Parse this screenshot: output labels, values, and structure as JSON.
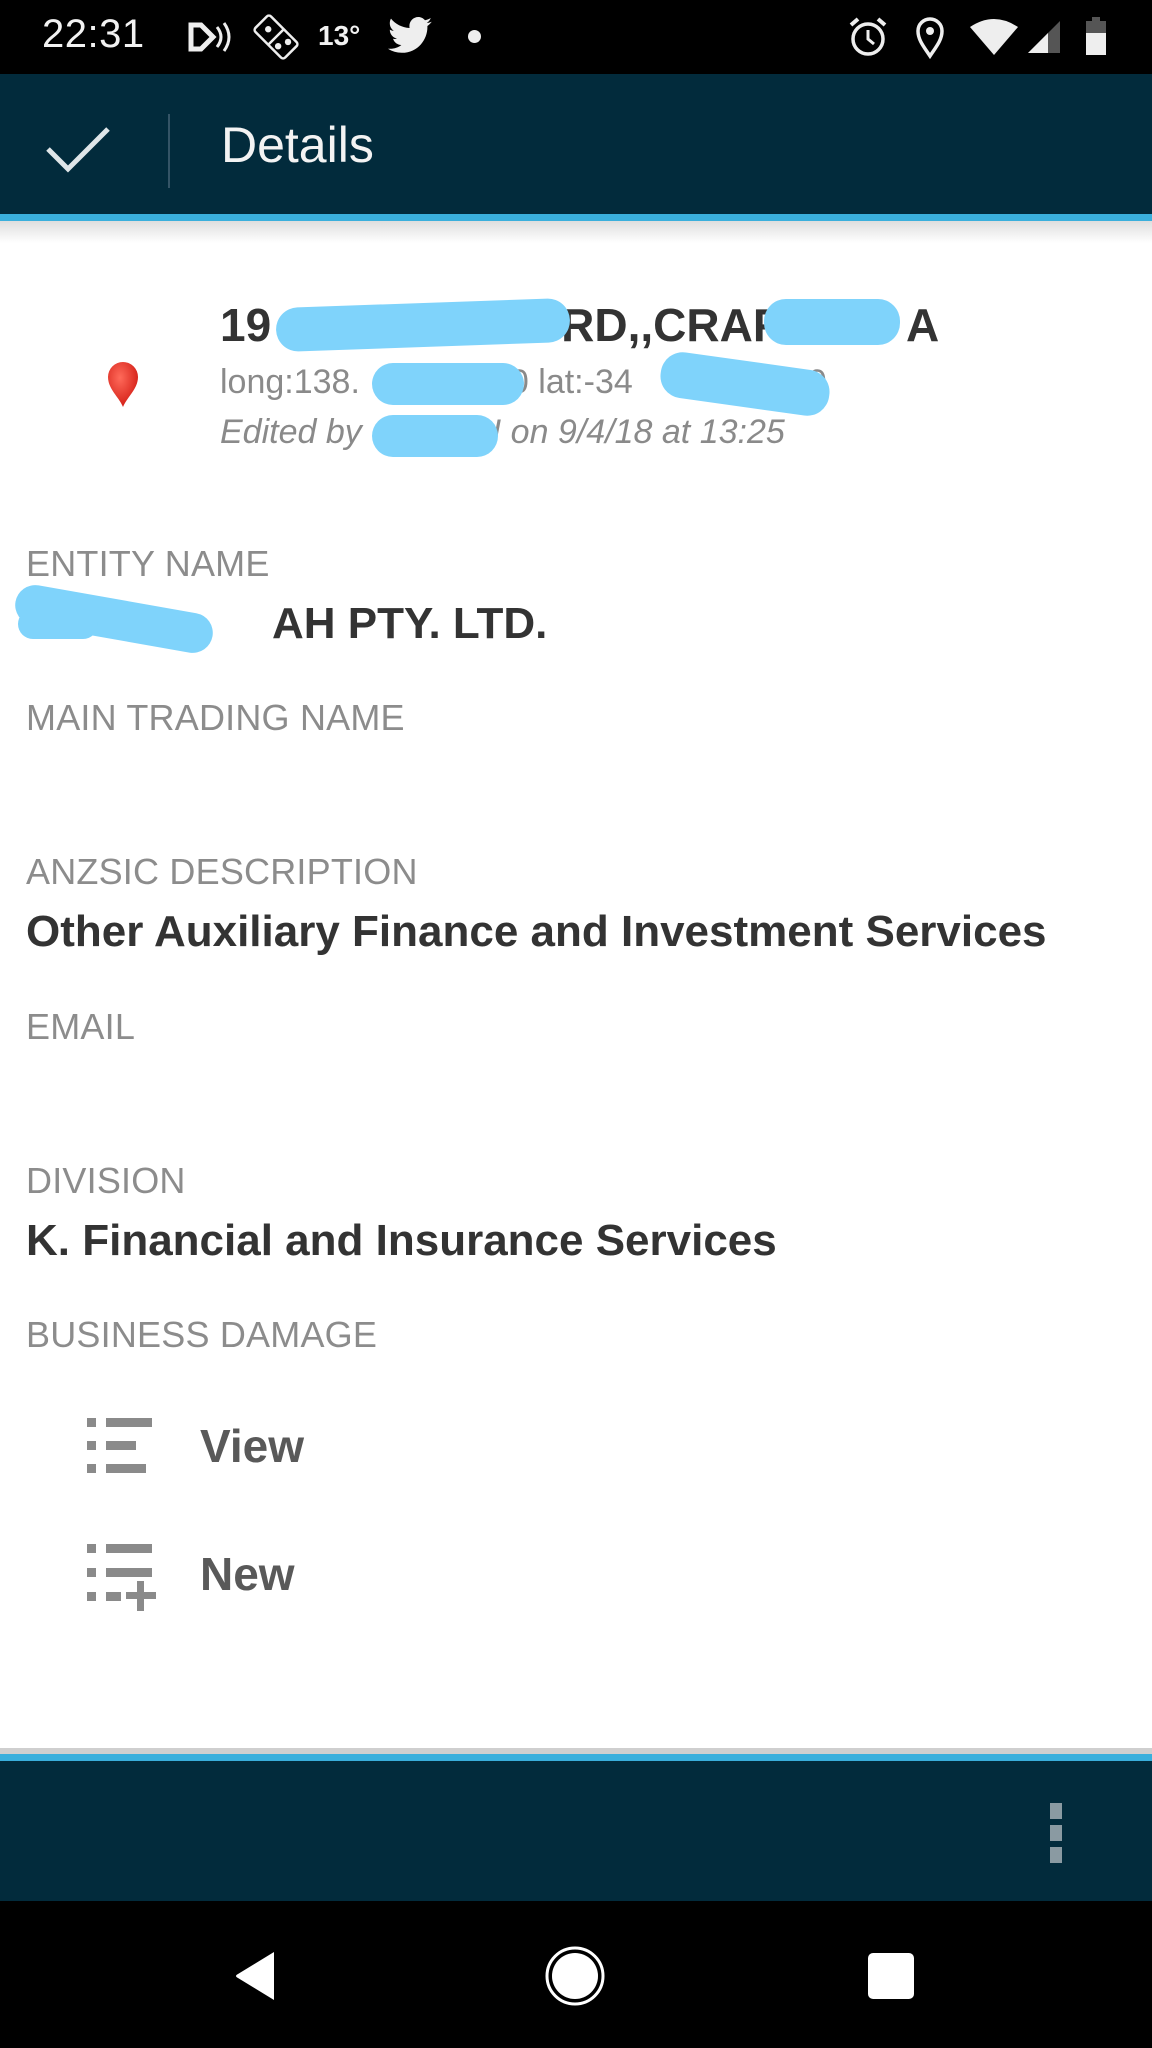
{
  "status_bar": {
    "time": "22:31",
    "temperature": "13°",
    "left_icons": [
      "cast-audio-icon",
      "dominos-icon",
      "twitter-icon",
      "notification-dot-icon"
    ],
    "right_icons": [
      "alarm-icon",
      "location-icon",
      "wifi-icon",
      "cell-signal-icon",
      "battery-icon"
    ]
  },
  "app_bar": {
    "title": "Details",
    "confirm_icon": "check-icon",
    "background": "#022b3c",
    "accent": "#3aafdc"
  },
  "address": {
    "line_visible_prefix": "19",
    "line_visible_middle": "RD,,CRAF",
    "line_visible_suffix": "A",
    "coords_prefix": "long:138.",
    "coords_middle": "0 lat:-34",
    "coords_suffix": "0",
    "edited_prefix": "Edited by",
    "edited_suffix": "I on 9/4/18 at 13:25",
    "marker_icon": "map-marker-icon",
    "marker_color": "#e8322b",
    "redaction_color": "#7fd3fb"
  },
  "fields": [
    {
      "label": "ENTITY NAME",
      "value": "AH PTY. LTD."
    },
    {
      "label": "MAIN TRADING NAME",
      "value": ""
    },
    {
      "label": "ANZSIC DESCRIPTION",
      "value": "Other Auxiliary Finance and Investment Services"
    },
    {
      "label": "EMAIL",
      "value": ""
    },
    {
      "label": "DIVISION",
      "value": "K. Financial and Insurance Services"
    },
    {
      "label": "BUSINESS DAMAGE",
      "value": ""
    }
  ],
  "business_damage_actions": [
    {
      "label": "View",
      "icon": "list-icon"
    },
    {
      "label": "New",
      "icon": "playlist-add-icon"
    }
  ],
  "bottom_bar": {
    "overflow_icon": "more-vertical-icon"
  },
  "nav_bar": {
    "buttons": [
      "back-icon",
      "home-icon",
      "recents-icon"
    ]
  }
}
